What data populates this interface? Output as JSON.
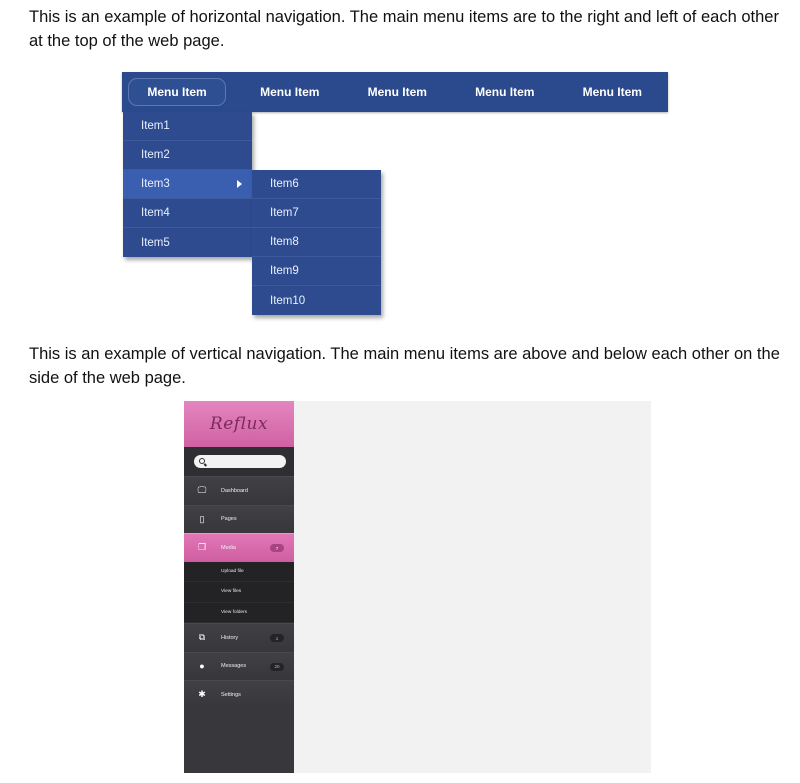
{
  "paragraphs": {
    "horizontal": "This is an example of horizontal navigation. The main menu items are to the right and left of each other at the top of the web page.",
    "vertical": "This is an example of vertical navigation. The main menu items are above and below each other on the side of the web page."
  },
  "horizontal_menu": {
    "items": [
      "Menu Item",
      "Menu Item",
      "Menu Item",
      "Menu Item",
      "Menu Item"
    ],
    "dropdown_1": [
      "Item1",
      "Item2",
      "Item3",
      "Item4",
      "Item5"
    ],
    "dropdown_2": [
      "Item6",
      "Item7",
      "Item8",
      "Item9",
      "Item10"
    ],
    "colors": {
      "bar": "#2b4a8d",
      "hover": "#3a5fb0"
    }
  },
  "vertical_menu": {
    "logo": "Reflux",
    "search_placeholder": "",
    "items": [
      {
        "label": "Dashboard",
        "icon": "monitor-icon"
      },
      {
        "label": "Pages",
        "icon": "page-icon"
      },
      {
        "label": "Media",
        "icon": "media-icon",
        "badge": "7"
      },
      {
        "label": "History",
        "icon": "history-icon",
        "badge": "1"
      },
      {
        "label": "Messages",
        "icon": "messages-icon",
        "badge": "20"
      },
      {
        "label": "Settings",
        "icon": "gear-icon"
      }
    ],
    "media_sub": [
      "Upload file",
      "View files",
      "View folders"
    ],
    "colors": {
      "accent": "#d868aa",
      "sidebar": "#38383c"
    }
  }
}
